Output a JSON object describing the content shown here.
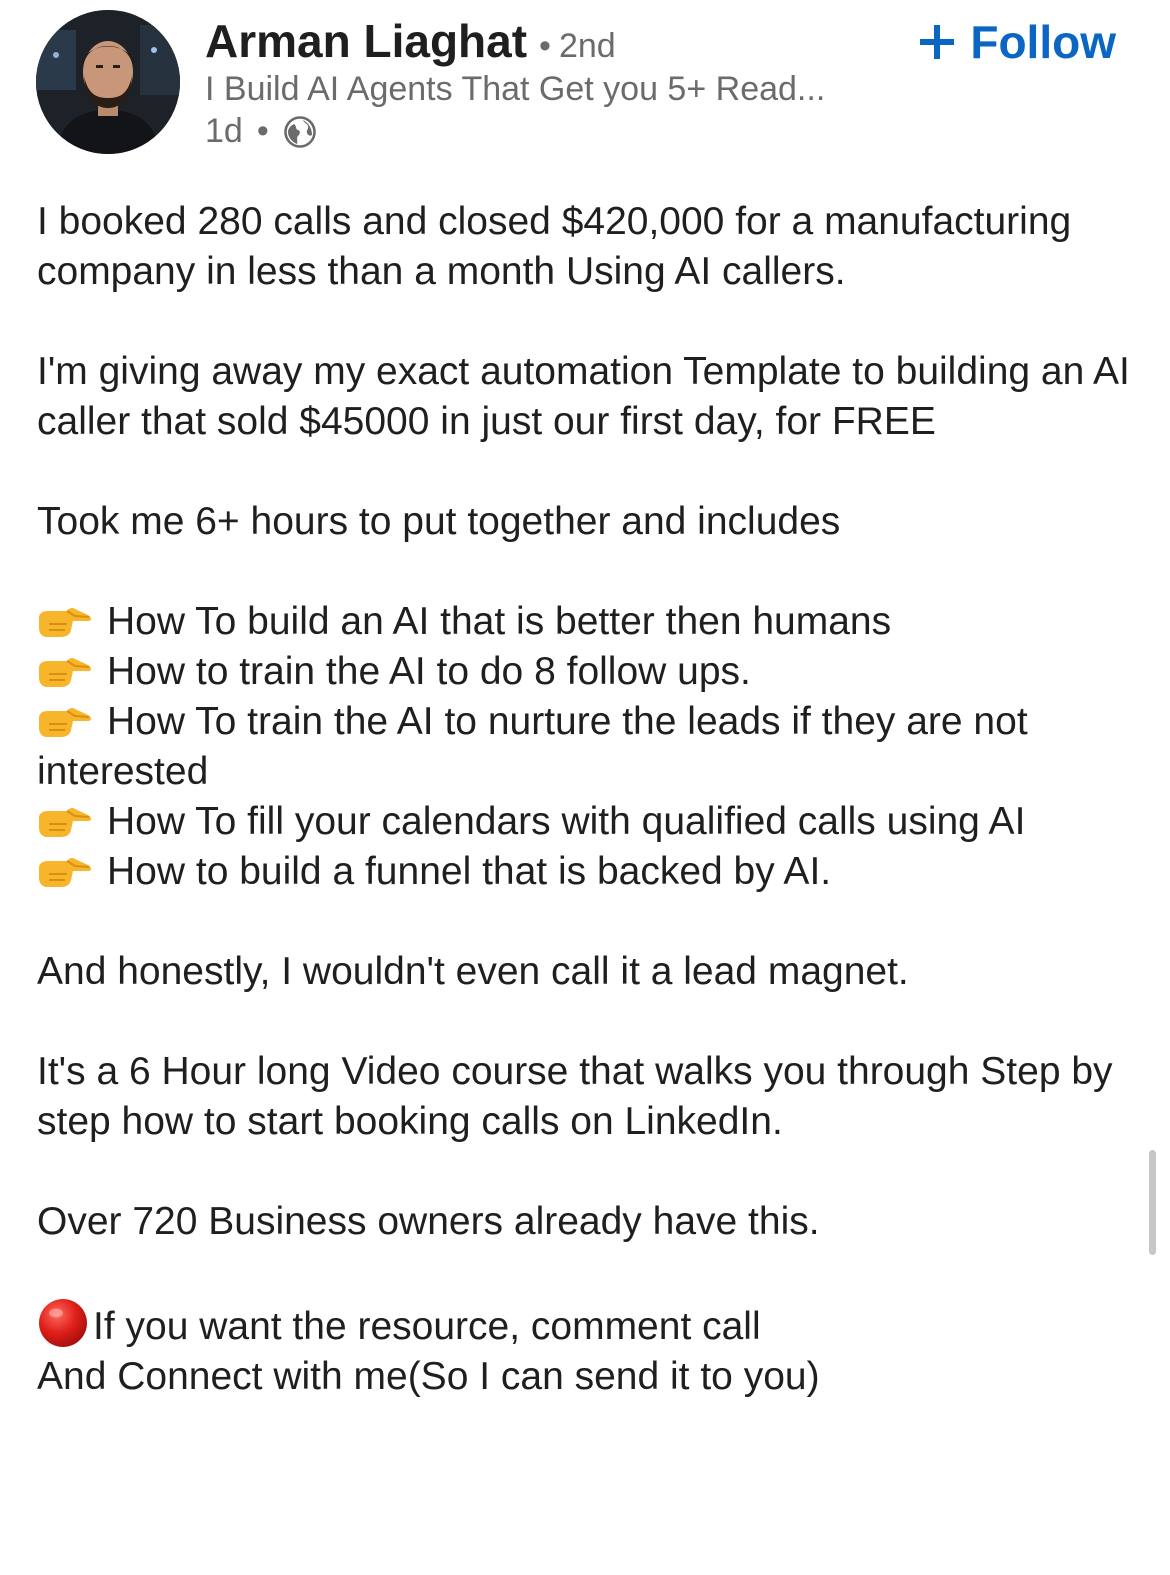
{
  "post": {
    "author": {
      "name": "Arman Liaghat",
      "degree_separator": "•",
      "degree": "2nd",
      "headline": "I Build AI Agents That Get you 5+ Read...",
      "time": "1d",
      "time_separator": "•",
      "visibility_icon": "globe-icon"
    },
    "follow_label": "Follow",
    "follow_icon": "plus-icon",
    "paragraphs": [
      "I booked 280 calls and closed $420,000 for a manufacturing company in less than a month Using AI callers.",
      "I'm giving away my exact automation Template to building an AI caller that sold $45000 in just our first day, for FREE",
      "Took me 6+ hours to put together and includes"
    ],
    "bullet_icon": "pointing-hand-icon",
    "bullets": [
      "How To build an AI that is better then humans",
      "How to train the AI to do 8 follow ups.",
      "How To train the AI to nurture the leads if they are not interested",
      "How To fill your calendars with qualified calls using AI",
      "How to build a funnel that is backed by AI."
    ],
    "closing_paragraphs": [
      "And honestly, I wouldn't even call it a lead magnet.",
      "It's a 6 Hour long Video course that walks you through Step by step how to start booking calls on LinkedIn.",
      "Over 720 Business owners already have this."
    ],
    "cta_icon": "red-circle-icon",
    "cta_line1": "If you want the resource, comment call",
    "cta_line2": "And Connect with me(So I can send it to you)"
  },
  "colors": {
    "accent": "#0a66c2",
    "text": "#1f1f1f",
    "secondary_text": "#6b6b6b",
    "scrollbar": "#c7c7c7"
  }
}
